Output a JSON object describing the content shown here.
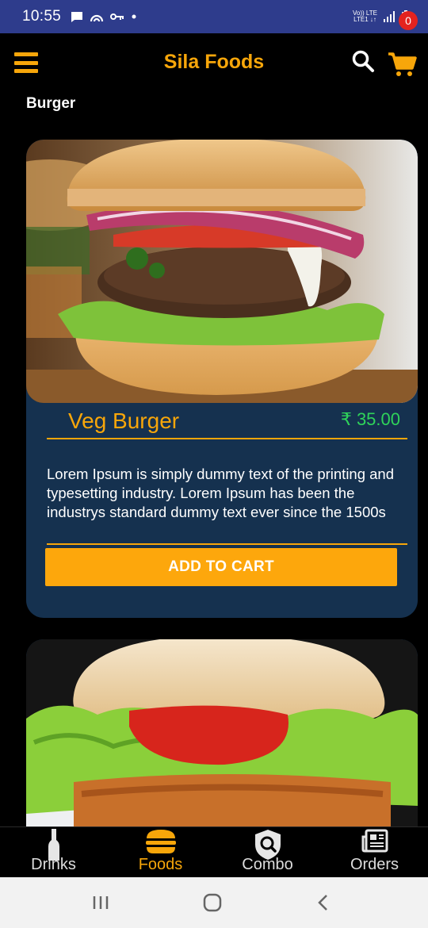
{
  "status_bar": {
    "time": "10:55",
    "network_top": "Vo)) LTE",
    "network_bottom": "LTE1 ↓↑"
  },
  "app_bar": {
    "title": "Sila Foods",
    "cart_count": "0"
  },
  "section": {
    "title": "Burger"
  },
  "products": [
    {
      "name": "Veg Burger",
      "price": "₹ 35.00",
      "description": "Lorem Ipsum is simply dummy text of the printing and typesetting industry. Lorem Ipsum has been the industrys standard dummy text ever since the 1500s",
      "button_label": "ADD TO CART"
    }
  ],
  "bottom_nav": {
    "items": [
      {
        "label": "Drinks",
        "icon": "bottle-icon"
      },
      {
        "label": "Foods",
        "icon": "burger-icon"
      },
      {
        "label": "Combo",
        "icon": "shield-search-icon"
      },
      {
        "label": "Orders",
        "icon": "newspaper-icon"
      }
    ],
    "active": "Foods"
  },
  "colors": {
    "accent": "#f7a60a",
    "card_bg": "#15314f",
    "price": "#2fd35a",
    "status_bar": "#2e3c8c",
    "badge": "#e4231f"
  }
}
